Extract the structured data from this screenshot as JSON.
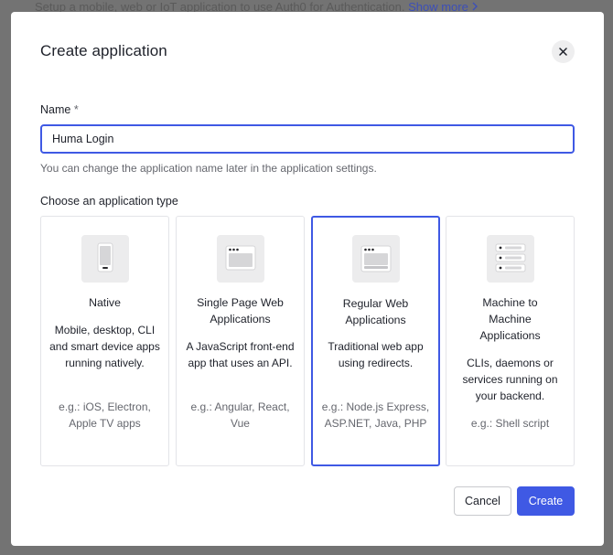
{
  "background": {
    "text": "Setup a mobile, web or IoT application to use Auth0 for Authentication.",
    "link": "Show more",
    "link_icon": "chevron-right-icon"
  },
  "modal": {
    "title": "Create application",
    "close_icon": "close-icon",
    "name_label": "Name",
    "required_mark": "*",
    "name_value": "Huma Login",
    "helper_text": "You can change the application name later in the application settings.",
    "type_label": "Choose an application type",
    "app_types": [
      {
        "icon": "mobile-phone-icon",
        "title": "Native",
        "description": "Mobile, desktop, CLI and smart device apps running natively.",
        "example": "e.g.: iOS, Electron, Apple TV apps",
        "selected": false
      },
      {
        "icon": "browser-window-icon",
        "title": "Single Page Web Applications",
        "description": "A JavaScript front-end app that uses an API.",
        "example": "e.g.: Angular, React, Vue",
        "selected": false
      },
      {
        "icon": "web-server-window-icon",
        "title": "Regular Web Applications",
        "description": "Traditional web app using redirects.",
        "example": "e.g.: Node.js Express, ASP.NET, Java, PHP",
        "selected": true
      },
      {
        "icon": "server-stack-icon",
        "title": "Machine to Machine Applications",
        "description": "CLIs, daemons or services running on your backend.",
        "example": "e.g.: Shell script",
        "selected": false
      }
    ],
    "cancel_label": "Cancel",
    "create_label": "Create"
  },
  "colors": {
    "accent": "#3f59e4",
    "overlay": "#737373",
    "muted_text": "#65676e",
    "icon_tile": "#ececed"
  }
}
